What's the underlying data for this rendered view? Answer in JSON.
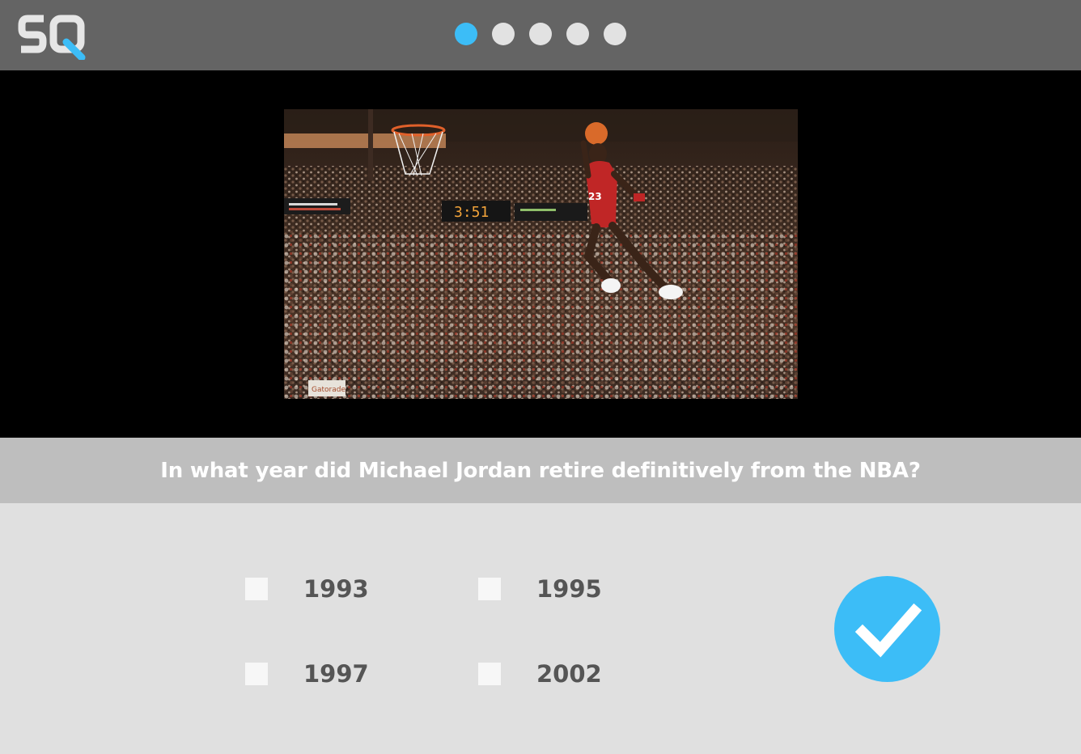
{
  "header": {
    "logo_text": "SQ",
    "progress": {
      "current": 1,
      "total": 5,
      "accent_color": "#3cbdf7",
      "inactive_color": "#e2e2e2"
    }
  },
  "media": {
    "scoreboard_clock": "3:51",
    "sign_text": "Gatorade"
  },
  "question": {
    "text": "In what year did Michael Jordan retire definitively from the NBA?"
  },
  "options": [
    {
      "label": "1993",
      "checked": false
    },
    {
      "label": "1995",
      "checked": false
    },
    {
      "label": "1997",
      "checked": false
    },
    {
      "label": "2002",
      "checked": false
    }
  ],
  "submit": {
    "icon": "checkmark-icon",
    "color": "#3cbdf7"
  }
}
